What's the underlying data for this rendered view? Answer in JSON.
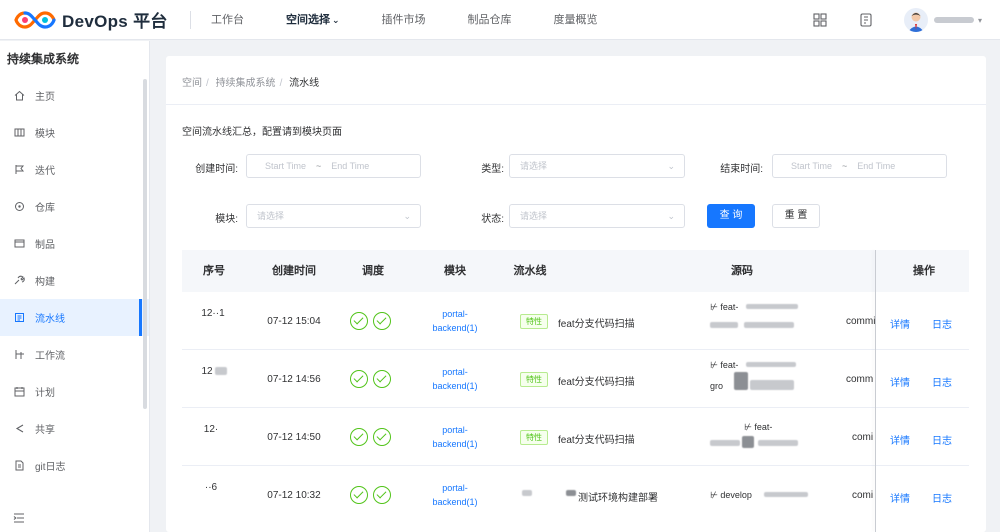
{
  "app": {
    "title": "DevOps 平台",
    "colors": {
      "primary": "#1677ff",
      "success": "#52c41a"
    }
  },
  "topnav": [
    {
      "label": "工作台",
      "active": false
    },
    {
      "label": "空间选择",
      "active": true
    },
    {
      "label": "插件市场",
      "active": false
    },
    {
      "label": "制品仓库",
      "active": false
    },
    {
      "label": "度量概览",
      "active": false
    }
  ],
  "topbar_icons": [
    "grid-icon",
    "document-icon"
  ],
  "sidebar": {
    "title": "持续集成系统",
    "items": [
      {
        "label": "主页",
        "icon": "home-icon",
        "active": false
      },
      {
        "label": "模块",
        "icon": "module-icon",
        "active": false
      },
      {
        "label": "迭代",
        "icon": "iteration-icon",
        "active": false
      },
      {
        "label": "仓库",
        "icon": "repo-icon",
        "active": false
      },
      {
        "label": "制品",
        "icon": "artifact-icon",
        "active": false
      },
      {
        "label": "构建",
        "icon": "build-icon",
        "active": false
      },
      {
        "label": "流水线",
        "icon": "pipeline-icon",
        "active": true
      },
      {
        "label": "工作流",
        "icon": "workflow-icon",
        "active": false
      },
      {
        "label": "计划",
        "icon": "plan-icon",
        "active": false
      },
      {
        "label": "共享",
        "icon": "share-icon",
        "active": false
      },
      {
        "label": "git日志",
        "icon": "log-icon",
        "active": false
      }
    ]
  },
  "breadcrumb": [
    "空间",
    "持续集成系统",
    "流水线"
  ],
  "description": "空间流水线汇总，配置请到模块页面",
  "filters": {
    "created_label": "创建时间:",
    "type_label": "类型:",
    "finished_label": "结束时间:",
    "module_label": "模块:",
    "status_label": "状态:",
    "start_placeholder": "Start Time",
    "end_placeholder": "End Time",
    "range_sep": "~",
    "select_placeholder": "请选择",
    "query_button": "查 询",
    "reset_button": "重 置"
  },
  "table": {
    "headers": [
      "序号",
      "创建时间",
      "调度",
      "模块",
      "流水线",
      "源码",
      "操作"
    ],
    "rows": [
      {
        "id": "12··1",
        "created": "07-12 15:04",
        "module": "portal-backend(1)",
        "tag": "特性",
        "pipeline": "feat分支代码扫描",
        "source_a": "⊬ feat-",
        "source_b": "",
        "commit": "commi",
        "ops": [
          "详情",
          "日志"
        ]
      },
      {
        "id": "12",
        "created": "07-12 14:56",
        "module": "portal-backend(1)",
        "tag": "特性",
        "pipeline": "feat分支代码扫描",
        "source_a": "⊬ feat-",
        "source_b": "gro",
        "commit": "comm",
        "ops": [
          "详情",
          "日志"
        ]
      },
      {
        "id": "12·",
        "created": "07-12 14:50",
        "module": "portal-backend(1)",
        "tag": "特性",
        "pipeline": "feat分支代码扫描",
        "source_a": "⊬ feat-",
        "source_b": "",
        "commit": "comi",
        "ops": [
          "详情",
          "日志"
        ]
      },
      {
        "id": "··6",
        "created": "07-12 10:32",
        "module": "portal-backend(1)",
        "tag": "",
        "pipeline": "测试环境构建部署",
        "source_a": "⊬ develop",
        "source_b": "",
        "commit": "comi",
        "ops": [
          "详情",
          "日志"
        ]
      }
    ]
  }
}
